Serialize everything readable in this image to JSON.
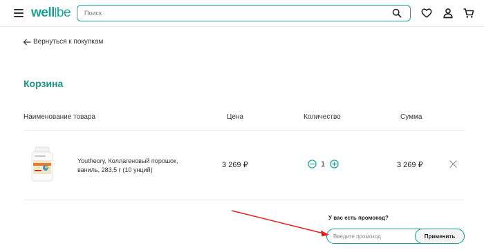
{
  "header": {
    "logo_text_a": "well",
    "logo_text_b": "be",
    "search": {
      "placeholder": "Поиск",
      "value": ""
    },
    "icons": [
      "menu-icon",
      "search-icon",
      "heart-icon",
      "user-icon",
      "cart-icon"
    ]
  },
  "nav": {
    "back_label": "Вернуться к покупкам"
  },
  "cart": {
    "title": "Корзина",
    "columns": {
      "name": "Наименование товара",
      "price": "Цена",
      "quantity": "Количество",
      "sum": "Сумма"
    },
    "items": [
      {
        "name": "Youtheory, Коллагеновый порошок, ваниль, 283,5 г (10 унций)",
        "price": "3 269 ₽",
        "quantity": "1",
        "sum": "3 269 ₽"
      }
    ]
  },
  "promo": {
    "question": "У вас есть промокод?",
    "placeholder": "Введите промокод",
    "apply_label": "Применить"
  },
  "colors": {
    "accent": "#1aa091",
    "title": "#1a9484",
    "arrow_annotation": "#e02020"
  }
}
